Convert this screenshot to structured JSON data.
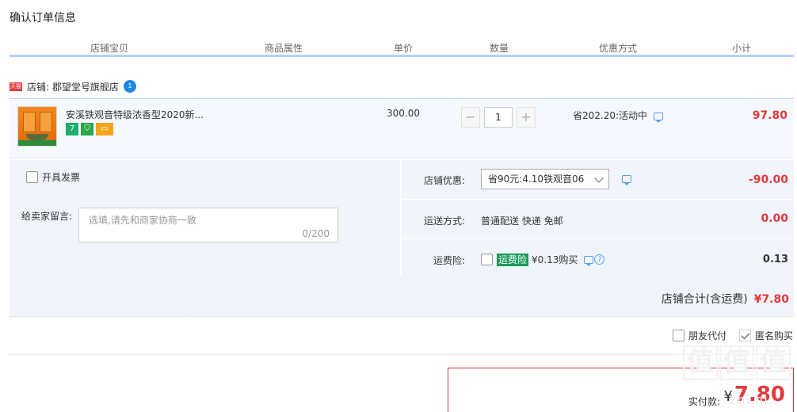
{
  "page_title": "确认订单信息",
  "columns": [
    "店铺宝贝",
    "商品属性",
    "单价",
    "数量",
    "优惠方式",
    "小计"
  ],
  "shop": {
    "badge": "天猫",
    "label": "店铺: 郡望堂号旗舰店"
  },
  "item": {
    "name": "安溪铁观音特级浓香型2020新...",
    "price": "300.00",
    "quantity": "1",
    "discount": "省202.20:活动中",
    "subtotal": "97.80",
    "service_icons": [
      "7-day-return-icon",
      "guarantee-icon",
      "credit-card-icon"
    ]
  },
  "options": {
    "invoice_label": "开具发票",
    "message_label": "给卖家留言:",
    "message_placeholder": "选填,请先和商家协商一致",
    "message_counter": "0/200",
    "shop_discount_label": "店铺优惠:",
    "shop_discount_selected": "省90元:4.10铁观音06",
    "shop_discount_value": "-90.00",
    "shipping_label": "运送方式:",
    "shipping_text": "普通配送 快递 免邮",
    "shipping_value": "0.00",
    "insurance_label": "运费险:",
    "insurance_badge": "运费险",
    "insurance_text": "¥0.13购买",
    "insurance_value": "0.13",
    "shop_total_label": "店铺合计(含运费)",
    "shop_total_value": "¥7.80"
  },
  "footer": {
    "friend_pay_label": "朋友代付",
    "anonymous_label": "匿名购买",
    "anonymous_checked": true,
    "final_label": "实付款:",
    "currency": "¥",
    "final_value": "7.80"
  },
  "watermark": {
    "logo": "值值值",
    "url": "zhi.hi..."
  },
  "colors": {
    "accent_red": "#e4393c",
    "row_bg": "#f5f9ff",
    "header_line": "#b2d1ff"
  }
}
